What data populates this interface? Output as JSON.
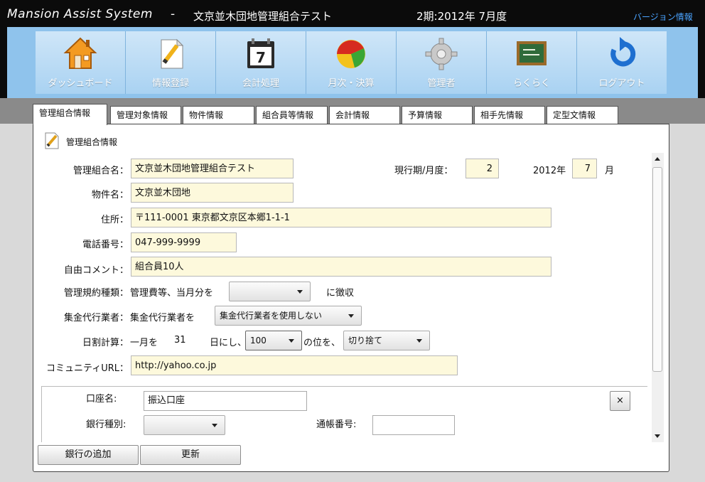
{
  "titlebar": {
    "app_name": "Mansion Assist System",
    "separator": "-",
    "org_name": "文京並木団地管理組合テスト",
    "period": "2期:2012年 7月度",
    "version_link": "バージョン情報"
  },
  "toolbar": [
    {
      "label": "ダッシュボード",
      "icon": "home-icon"
    },
    {
      "label": "情報登録",
      "icon": "pencil-document-icon"
    },
    {
      "label": "会計処理",
      "icon": "calendar-icon"
    },
    {
      "label": "月次・決算",
      "icon": "pie-chart-icon"
    },
    {
      "label": "管理者",
      "icon": "gear-icon"
    },
    {
      "label": "らくらく",
      "icon": "blackboard-icon"
    },
    {
      "label": "ログアウト",
      "icon": "logout-arrow-icon"
    }
  ],
  "tabs": [
    "管理組合情報",
    "管理対象情報",
    "物件情報",
    "組合員等情報",
    "会計情報",
    "予算情報",
    "相手先情報",
    "定型文情報"
  ],
  "panel": {
    "header": "管理組合情報",
    "form": {
      "org_name_label": "管理組合名：",
      "org_name_value": "文京並木団地管理組合テスト",
      "current_period_label": "現行期/月度：",
      "current_period_value": "2",
      "year_label": "2012年",
      "month_value": "7",
      "month_label": "月",
      "property_label": "物件名：",
      "property_value": "文京並木団地",
      "address_label": "住所：",
      "address_value": "〒111-0001  東京都文京区本郷1-1-1",
      "phone_label": "電話番号：",
      "phone_value": "047-999-9999",
      "comment_label": "自由コメント：",
      "comment_value": "組合員10人",
      "bylaw_label": "管理規約種類：",
      "bylaw_text": "管理費等、当月分を",
      "bylaw_select": "",
      "bylaw_suffix": "に徴収",
      "collector_label": "集金代行業者：",
      "collector_text": "集金代行業者を",
      "collector_select": "集金代行業者を使用しない",
      "daily_label": "日割計算：",
      "daily_text1": "一月を",
      "daily_days": "31",
      "daily_text2": "日にし、",
      "daily_round_select": "100",
      "daily_text3": "の位を、",
      "daily_method_select": "切り捨て",
      "url_label": "コミュニティURL：",
      "url_value": "http://yahoo.co.jp"
    },
    "bank": {
      "account_name_label": "口座名:",
      "account_name_value": "振込口座",
      "bank_type_label": "銀行種別:",
      "bank_type_select": "",
      "passbook_label": "通帳番号:",
      "passbook_value": "",
      "remove_button": "×"
    },
    "buttons": {
      "add_bank": "銀行の追加",
      "update": "更新"
    }
  },
  "colors": {
    "titlebar_bg": "#0b0b0b",
    "toolbar_bg": "#8fc3ec",
    "field_bg": "#fdf9dc",
    "link": "#4aa3ff"
  }
}
